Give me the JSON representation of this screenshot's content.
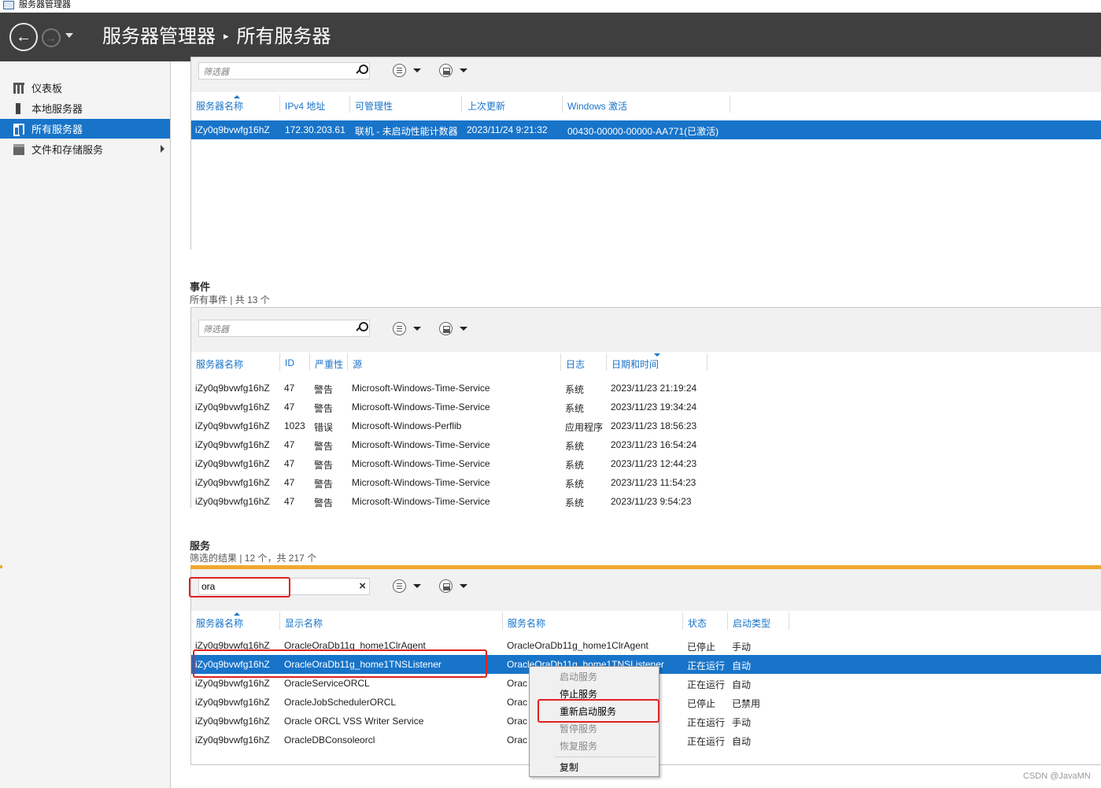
{
  "window": {
    "title": "服务器管理器"
  },
  "header": {
    "app": "服务器管理器",
    "separator": "▸",
    "page": "所有服务器"
  },
  "sidebar": {
    "items": [
      {
        "label": "仪表板"
      },
      {
        "label": "本地服务器"
      },
      {
        "label": "所有服务器"
      },
      {
        "label": "文件和存储服务"
      }
    ]
  },
  "servers": {
    "filter_placeholder": "筛选器",
    "columns": [
      "服务器名称",
      "IPv4 地址",
      "可管理性",
      "上次更新",
      "Windows 激活"
    ],
    "rows": [
      [
        "iZy0q9bvwfg16hZ",
        "172.30.203.61",
        "联机 - 未启动性能计数器",
        "2023/11/24 9:21:32",
        "00430-00000-00000-AA771(已激活)"
      ]
    ]
  },
  "events": {
    "title": "事件",
    "subtitle": "所有事件 | 共 13 个",
    "filter_placeholder": "筛选器",
    "columns": [
      "服务器名称",
      "ID",
      "严重性",
      "源",
      "日志",
      "日期和时间"
    ],
    "rows": [
      [
        "iZy0q9bvwfg16hZ",
        "47",
        "警告",
        "Microsoft-Windows-Time-Service",
        "系统",
        "2023/11/23 21:19:24"
      ],
      [
        "iZy0q9bvwfg16hZ",
        "47",
        "警告",
        "Microsoft-Windows-Time-Service",
        "系统",
        "2023/11/23 19:34:24"
      ],
      [
        "iZy0q9bvwfg16hZ",
        "1023",
        "错误",
        "Microsoft-Windows-Perflib",
        "应用程序",
        "2023/11/23 18:56:23"
      ],
      [
        "iZy0q9bvwfg16hZ",
        "47",
        "警告",
        "Microsoft-Windows-Time-Service",
        "系统",
        "2023/11/23 16:54:24"
      ],
      [
        "iZy0q9bvwfg16hZ",
        "47",
        "警告",
        "Microsoft-Windows-Time-Service",
        "系统",
        "2023/11/23 12:44:23"
      ],
      [
        "iZy0q9bvwfg16hZ",
        "47",
        "警告",
        "Microsoft-Windows-Time-Service",
        "系统",
        "2023/11/23 11:54:23"
      ],
      [
        "iZy0q9bvwfg16hZ",
        "47",
        "警告",
        "Microsoft-Windows-Time-Service",
        "系统",
        "2023/11/23 9:54:23"
      ]
    ]
  },
  "services": {
    "title": "服务",
    "subtitle": "筛选的结果 | 12 个，共 217 个",
    "filter_value": "ora",
    "clear_glyph": "×",
    "columns": [
      "服务器名称",
      "显示名称",
      "服务名称",
      "状态",
      "启动类型"
    ],
    "rows": [
      [
        "iZy0q9bvwfg16hZ",
        "OracleOraDb11g_home1ClrAgent",
        "OracleOraDb11g_home1ClrAgent",
        "已停止",
        "手动"
      ],
      [
        "iZy0q9bvwfg16hZ",
        "OracleOraDb11g_home1TNSListener",
        "OracleOraDb11g_home1TNSListener",
        "正在运行",
        "自动"
      ],
      [
        "iZy0q9bvwfg16hZ",
        "OracleServiceORCL",
        "Orac",
        "正在运行",
        "自动"
      ],
      [
        "iZy0q9bvwfg16hZ",
        "OracleJobSchedulerORCL",
        "Orac",
        "已停止",
        "已禁用"
      ],
      [
        "iZy0q9bvwfg16hZ",
        "Oracle ORCL VSS Writer Service",
        "Orac",
        "正在运行",
        "手动"
      ],
      [
        "iZy0q9bvwfg16hZ",
        "OracleDBConsoleorcl",
        "Orac",
        "正在运行",
        "自动"
      ]
    ]
  },
  "context_menu": {
    "items": [
      {
        "label": "启动服务",
        "enabled": false
      },
      {
        "label": "停止服务",
        "enabled": true
      },
      {
        "label": "重新启动服务",
        "enabled": true
      },
      {
        "label": "暂停服务",
        "enabled": false
      },
      {
        "label": "恢复服务",
        "enabled": false
      },
      {
        "label": "复制",
        "enabled": true
      }
    ]
  },
  "watermark": "CSDN @JavaMN",
  "colors": {
    "accent": "#1874c9",
    "header_bg": "#3f3f3f",
    "highlight_orange": "#f0a830",
    "annotation_red": "#e02020"
  },
  "icons": [
    "back-icon",
    "forward-icon",
    "search-icon",
    "clear-icon",
    "list-options-icon",
    "save-query-icon"
  ]
}
